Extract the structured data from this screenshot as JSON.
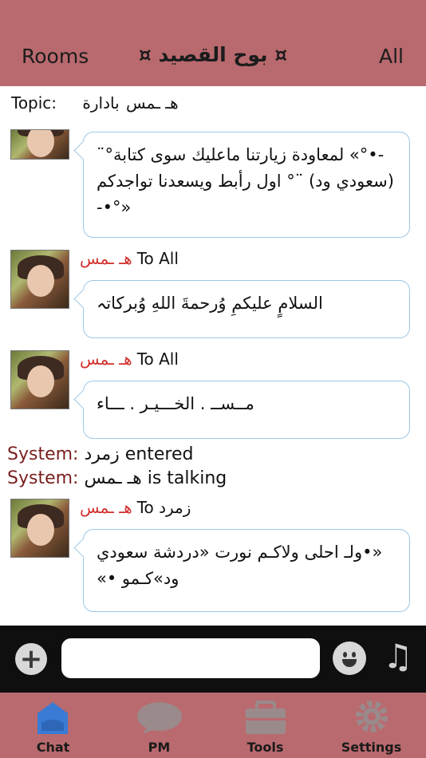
{
  "header": {
    "left": "Rooms",
    "title": "¤ بوح القصيد ¤",
    "right": "All"
  },
  "topic": {
    "label": "Topic:",
    "name": "هـ ـمس",
    "role": "بادارة"
  },
  "messages": [
    {
      "text": "-•°» لمعاودة زيارتنا ماعليك سوى كتابة°¨ (سعودي ود) ¨° اول رأبط ويسعدنا تواجدكم «°•-"
    },
    {
      "sender": "هـ ـمس",
      "to": "To All",
      "text": "السلامٍ عليكمِ وُرحمةَ اللهِ وُبركاتہ"
    },
    {
      "sender": "هـ ـمس",
      "to": "To All",
      "text": "مــســ . الخـــيـر . ـــاء"
    },
    {
      "sender": "هـ ـمس",
      "to": "To زمرد",
      "text": "«•ولـ احلى ولاكـم نورت «دردشة سعودي ود»كـمو •»"
    }
  ],
  "system": [
    {
      "label": "System:",
      "text": "زمرد entered"
    },
    {
      "label": "System:",
      "text": "هـ ـمس is talking"
    }
  ],
  "input": {
    "value": "",
    "plus": "+",
    "music": "♫"
  },
  "tabs": [
    {
      "label": "Chat",
      "icon": "chat-home-icon",
      "color": "#3a7bd5"
    },
    {
      "label": "PM",
      "icon": "speech-bubble-icon",
      "color": "#9a8a8c"
    },
    {
      "label": "Tools",
      "icon": "toolbox-icon",
      "color": "#9a8a8c"
    },
    {
      "label": "Settings",
      "icon": "gear-icon",
      "color": "#9a8a8c"
    }
  ]
}
